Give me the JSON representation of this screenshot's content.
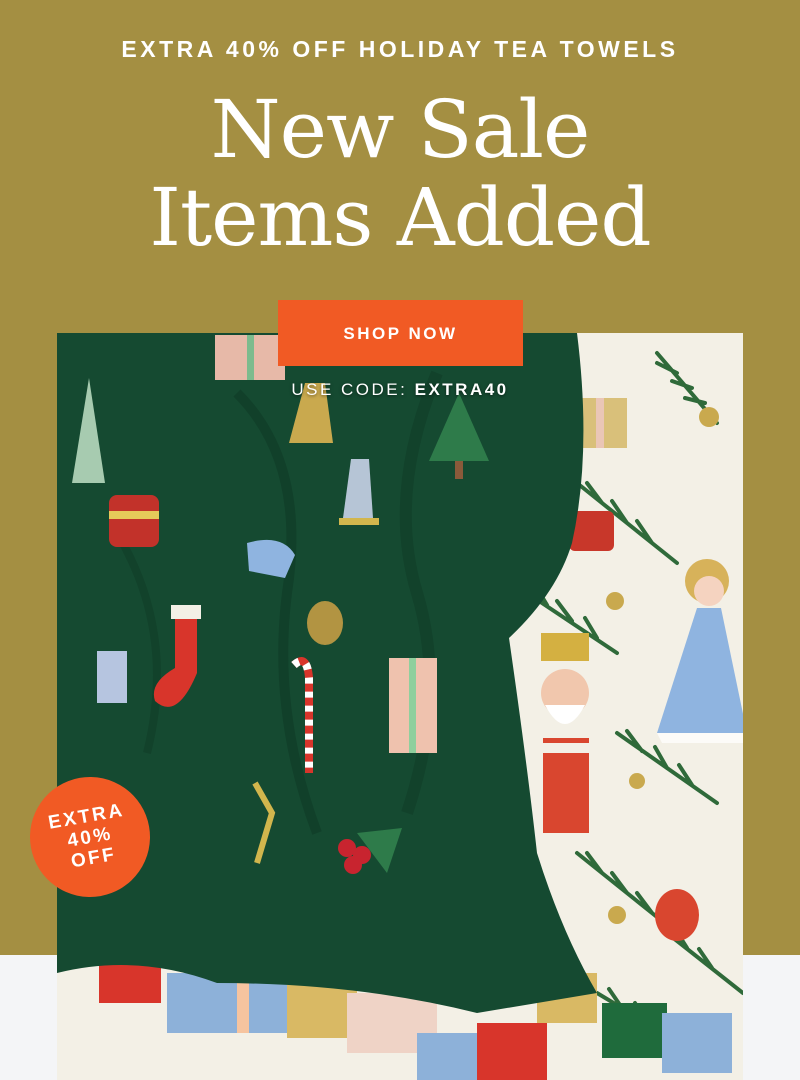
{
  "promo": {
    "eyebrow": "EXTRA 40% OFF HOLIDAY TEA TOWELS",
    "headline_line1": "New Sale",
    "headline_line2": "Items Added",
    "cta_label": "SHOP NOW",
    "code_prefix": "USE CODE:",
    "code_value": "EXTRA40"
  },
  "badge": {
    "line1": "EXTRA",
    "line2": "40%",
    "line3": "OFF"
  },
  "colors": {
    "banner_bg": "#a48f42",
    "cta_bg": "#f15a24",
    "badge_bg": "#f15a24",
    "towel_green": "#154a31",
    "towel_cream": "#f3f0e6"
  }
}
